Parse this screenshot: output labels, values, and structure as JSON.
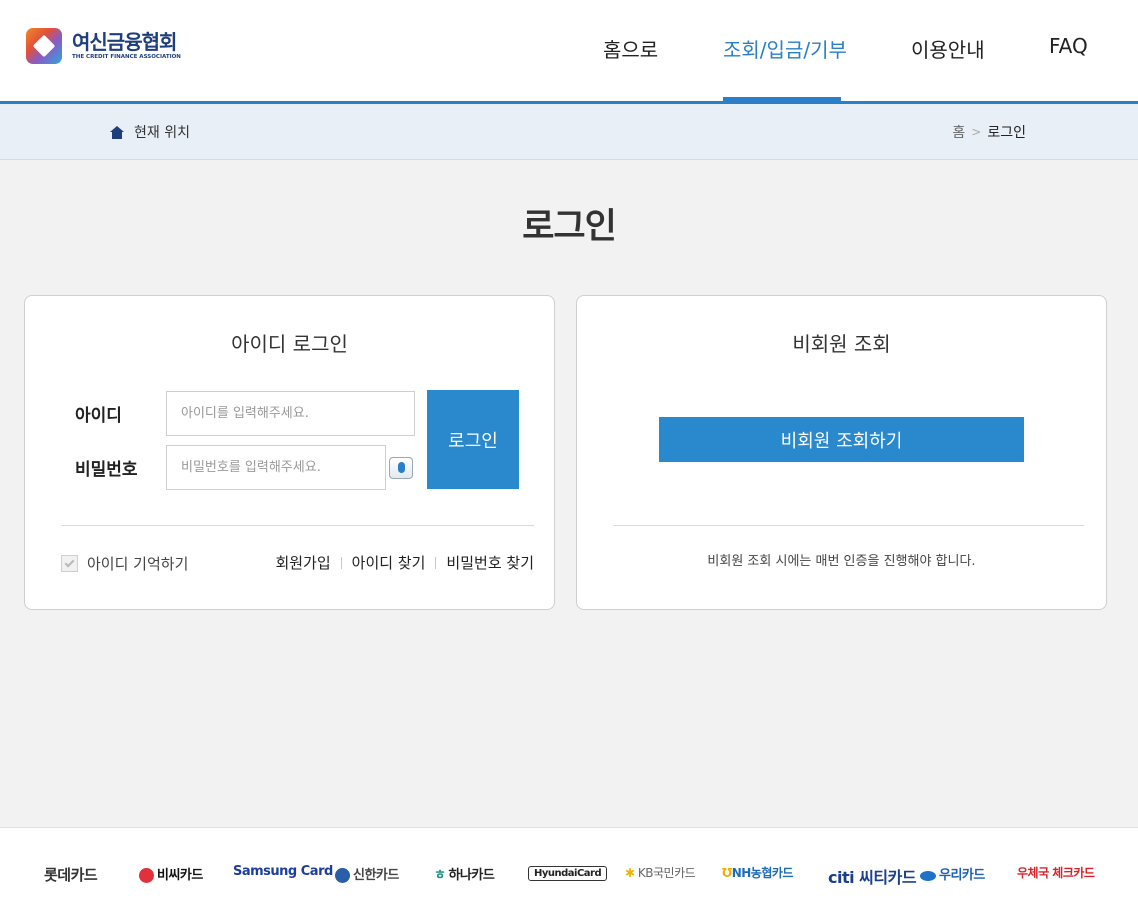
{
  "header": {
    "logo": {
      "name_ko": "여신금융협회",
      "name_en": "THE CREDIT FINANCE ASSOCIATION"
    },
    "nav": [
      {
        "label": "홈으로",
        "active": false
      },
      {
        "label": "조회/입금/기부",
        "active": true
      },
      {
        "label": "이용안내",
        "active": false
      },
      {
        "label": "FAQ",
        "active": false
      }
    ]
  },
  "breadcrumb": {
    "location_label": "현재 위치",
    "home_icon": "home-icon",
    "path": [
      "홈",
      "로그인"
    ],
    "separator": ">"
  },
  "page": {
    "title": "로그인"
  },
  "login_card": {
    "title": "아이디 로그인",
    "id_label": "아이디",
    "id_placeholder": "아이디를 입력해주세요.",
    "pw_label": "비밀번호",
    "pw_placeholder": "비밀번호를 입력해주세요.",
    "keyboard_icon": "mouse-keyboard-icon",
    "submit_label": "로그인",
    "remember_label": "아이디 기억하기",
    "remember_checked": true,
    "links": [
      "회원가입",
      "아이디 찾기",
      "비밀번호 찾기"
    ]
  },
  "guest_card": {
    "title": "비회원 조회",
    "button_label": "비회원 조회하기",
    "note": "비회원 조회 시에는 매번 인증을 진행해야 합니다."
  },
  "footer": {
    "brands": [
      "롯데카드",
      "비씨카드",
      "Samsung Card",
      "신한카드",
      "하나카드",
      "HyundaiCard",
      "KB국민카드",
      "NH농협카드",
      "citi 씨티카드",
      "우리카드",
      "우체국 체크카드"
    ]
  },
  "colors": {
    "accent": "#2a88cc",
    "nav_active": "#2a7fc6",
    "logo_text": "#1f3e7c",
    "crumb_bg": "#e9eff6",
    "page_bg": "#f2f2f2"
  }
}
